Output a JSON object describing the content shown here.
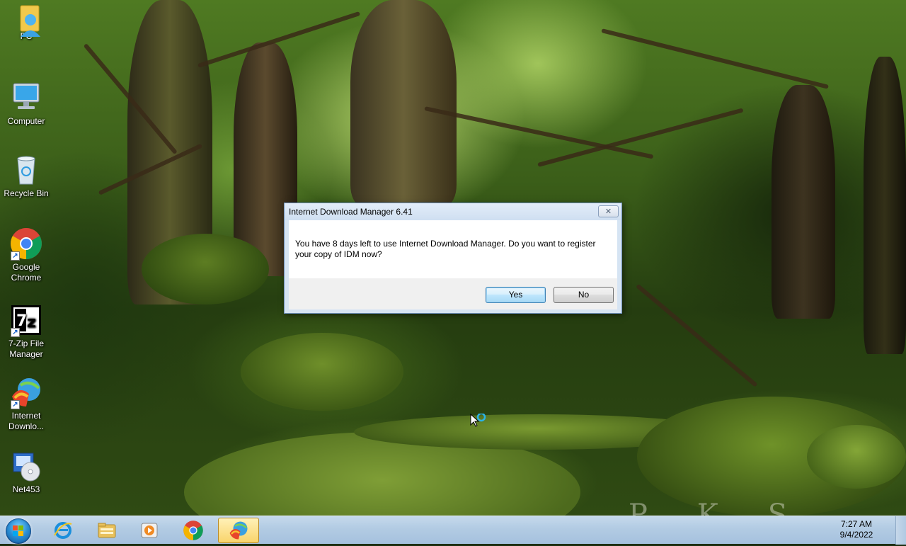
{
  "desktop": {
    "icons": [
      {
        "label": "PC"
      },
      {
        "label": "Computer"
      },
      {
        "label": "Recycle Bin"
      },
      {
        "label": "Google Chrome"
      },
      {
        "label": "7-Zip File Manager"
      },
      {
        "label": "Internet Downlo..."
      },
      {
        "label": "Net453"
      }
    ],
    "wallpaper_text": "PKS"
  },
  "dialog": {
    "title": "Internet Download Manager 6.41",
    "message": "You have 8 days left to use Internet Download Manager. Do you want to register your copy of IDM now?",
    "yes_label": "Yes",
    "no_label": "No",
    "close_glyph": "✕"
  },
  "taskbar": {
    "pinned": [
      "start-orb",
      "internet-explorer-icon",
      "file-explorer-icon",
      "media-player-icon",
      "chrome-icon",
      "idm-icon"
    ],
    "active": "idm-icon",
    "clock": {
      "time": "7:27 AM",
      "date": "9/4/2022"
    }
  },
  "colors": {
    "taskbar": "#b2cbe3",
    "dialog_frame": "#d6e4f3",
    "default_button_border": "#3c7fb1"
  }
}
